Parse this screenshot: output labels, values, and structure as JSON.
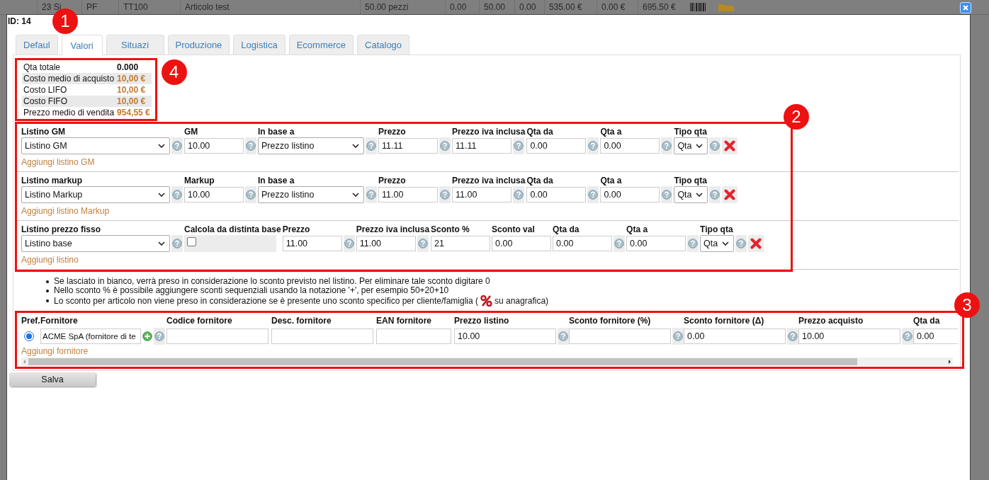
{
  "background_row": {
    "cells": [
      "23 Si",
      "PF",
      "TT100",
      "Articolo test",
      "50.00 pezzi",
      "0.00",
      "50.00",
      "0.00",
      "535.00 €",
      "0.00 €",
      "695.50 €"
    ]
  },
  "dialog": {
    "id_label": "ID: 14",
    "tabs_callout": "1",
    "tabs": [
      {
        "label": "Defaul",
        "selected": false
      },
      {
        "label": "Valori",
        "selected": true
      },
      {
        "label": "Situazi",
        "selected": false
      },
      {
        "label": "Produzione",
        "selected": false
      },
      {
        "label": "Logistica",
        "selected": false
      },
      {
        "label": "Ecommerce",
        "selected": false
      },
      {
        "label": "Catalogo",
        "selected": false
      }
    ],
    "summary": {
      "callout": "4",
      "rows": [
        {
          "label": "Qta totale",
          "value": "0.000",
          "kind": "quantity"
        },
        {
          "label": "Costo medio di acquisto",
          "value": "10,00 €",
          "kind": "amount"
        },
        {
          "label": "Costo LIFO",
          "value": "10,00 €",
          "kind": "amount"
        },
        {
          "label": "Costo FIFO",
          "value": "10,00 €",
          "kind": "amount"
        },
        {
          "label": "Prezzo medio di vendita",
          "value": "954,55 €",
          "kind": "amount"
        }
      ]
    },
    "pricing": {
      "callout": "2",
      "sections": [
        {
          "removable": true,
          "add_link": "Aggiungi listino GM",
          "fields": [
            {
              "kind": "list_select",
              "label": "Listino GM",
              "value": "Listino GM",
              "help": true
            },
            {
              "kind": "input",
              "label": "GM",
              "value": "10.00",
              "help": true
            },
            {
              "kind": "select",
              "label": "In base a",
              "value": "Prezzo listino",
              "help": true
            },
            {
              "kind": "input",
              "label": "Prezzo",
              "value": "11.11",
              "help": true
            },
            {
              "kind": "input",
              "label": "Prezzo iva inclusa",
              "value": "11.11",
              "help": true
            },
            {
              "kind": "input",
              "label": "Qta da",
              "value": "0.00",
              "help": true
            },
            {
              "kind": "input",
              "label": "Qta a",
              "value": "0.00",
              "help": true
            },
            {
              "kind": "qty_select",
              "label": "Tipo qta",
              "value": "Qta",
              "help": true
            }
          ]
        },
        {
          "removable": true,
          "add_link": "Aggiungi listino Markup",
          "fields": [
            {
              "kind": "list_select",
              "label": "Listino markup",
              "value": "Listino Markup",
              "help": true
            },
            {
              "kind": "input",
              "label": "Markup",
              "value": "10.00",
              "help": true
            },
            {
              "kind": "select",
              "label": "In base a",
              "value": "Prezzo listino",
              "help": true
            },
            {
              "kind": "input",
              "label": "Prezzo",
              "value": "11.00",
              "help": true
            },
            {
              "kind": "input",
              "label": "Prezzo iva inclusa",
              "value": "11.00",
              "help": true
            },
            {
              "kind": "input",
              "label": "Qta da",
              "value": "0.00",
              "help": true
            },
            {
              "kind": "input",
              "label": "Qta a",
              "value": "0.00",
              "help": true
            },
            {
              "kind": "qty_select",
              "label": "Tipo qta",
              "value": "Qta",
              "help": true
            }
          ]
        },
        {
          "removable": true,
          "add_link": "Aggiungi listino",
          "fields": [
            {
              "kind": "list_select",
              "label": "Listino prezzo fisso",
              "value": "Listino base",
              "help": true
            },
            {
              "kind": "checkbox",
              "label": "Calcola da distinta base",
              "checked": false
            },
            {
              "kind": "input",
              "label": "Prezzo",
              "value": "11.00",
              "help": true
            },
            {
              "kind": "input",
              "label": "Prezzo iva inclusa",
              "value": "11.00",
              "help": true
            },
            {
              "kind": "input",
              "label": "Sconto %",
              "value": "21",
              "help": false
            },
            {
              "kind": "input",
              "label": "Sconto val",
              "value": "0.00",
              "help": false
            },
            {
              "kind": "input",
              "label": "Qta da",
              "value": "0.00",
              "help": true
            },
            {
              "kind": "input",
              "label": "Qta a",
              "value": "0.00",
              "help": true
            },
            {
              "kind": "qty_select",
              "label": "Tipo qta",
              "value": "Qta",
              "help": true
            }
          ]
        }
      ]
    },
    "notes": [
      {
        "kind": "plain",
        "text": "Se lasciato in bianco, verrà preso in considerazione lo sconto previsto nel listino. Per eliminare tale sconto digitare 0"
      },
      {
        "kind": "plain",
        "text": "Nello sconto % è possibile aggiungere sconti sequenziali usando la notazione '+', per esempio 50+20+10"
      },
      {
        "kind": "discount_icon",
        "text": "Lo sconto per articolo non viene preso in considerazione se è presente uno sconto specifico per cliente/famiglia (",
        "text_after": "su anagrafica)"
      }
    ],
    "suppliers": {
      "callout": "3",
      "columns": [
        "Pref.",
        "Fornitore",
        "Codice fornitore",
        "Desc. fornitore",
        "EAN fornitore",
        "Prezzo listino",
        "Sconto fornitore (%)",
        "Sconto fornitore (Δ)",
        "Prezzo acquisto",
        "Qta da"
      ],
      "rows": [
        {
          "cells": [
            {
              "kind": "radio",
              "selected": true
            },
            {
              "kind": "supplier",
              "value": "ACME SpA (fornitore di te",
              "help": true
            },
            {
              "kind": "text",
              "help": false
            },
            {
              "kind": "text",
              "help": false
            },
            {
              "kind": "short",
              "help": false
            },
            {
              "kind": "text",
              "value": "10.00",
              "help": true
            },
            {
              "kind": "text",
              "help": true
            },
            {
              "kind": "text",
              "value": "0.00",
              "help": true
            },
            {
              "kind": "text",
              "value": "10.00",
              "help": true
            },
            {
              "kind": "text",
              "value": "0.00",
              "help": false
            }
          ]
        }
      ],
      "add_link": "Aggiungi fornitore"
    },
    "save_label": "Salva"
  }
}
